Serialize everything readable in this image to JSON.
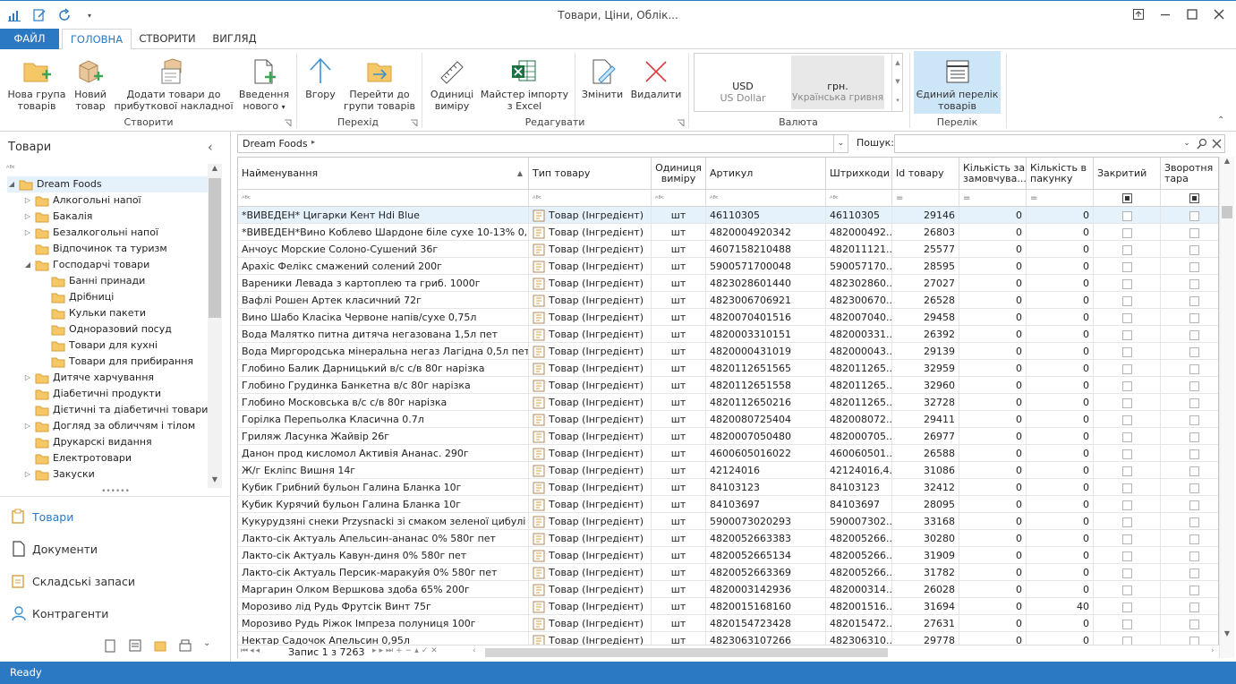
{
  "window": {
    "title": "Товари, Ціни, Облік..."
  },
  "tabs": [
    "ФАЙЛ",
    "ГОЛОВНА",
    "СТВОРИТИ",
    "ВИГЛЯД"
  ],
  "ribbon": {
    "create": {
      "label": "Створити",
      "b1": "Нова група товарів",
      "b2": "Новий товар",
      "b3": "Додати товари до прибуткової накладної",
      "b4": "Введення нового"
    },
    "nav": {
      "label": "Перехід",
      "b1": "Вгору",
      "b2": "Перейти до групи товарів"
    },
    "edit": {
      "label": "Редагувати",
      "b1": "Одиниці виміру",
      "b2": "Майстер імпорту з Excel",
      "b3": "Змінити",
      "b4": "Видалити"
    },
    "currency": {
      "label": "Валюта",
      "usd_code": "USD",
      "usd_name": "US Dollar",
      "uah_code": "грн.",
      "uah_name": "Українська гривня"
    },
    "list": {
      "label": "Перелік",
      "b1": "Єдиний перелік товарів"
    }
  },
  "left": {
    "title": "Товари",
    "tree": [
      {
        "label": "Dream Foods",
        "lvl": 0,
        "ex": "◢"
      },
      {
        "label": "Алкогольні напої",
        "lvl": 1,
        "ex": "▷"
      },
      {
        "label": "Бакалія",
        "lvl": 1,
        "ex": "▷"
      },
      {
        "label": "Безалкогольні напої",
        "lvl": 1,
        "ex": "▷"
      },
      {
        "label": "Відпочинок та туризм",
        "lvl": 1,
        "ex": ""
      },
      {
        "label": "Господарчі товари",
        "lvl": 1,
        "ex": "◢"
      },
      {
        "label": "Банні принади",
        "lvl": 2,
        "ex": ""
      },
      {
        "label": "Дрібниці",
        "lvl": 2,
        "ex": ""
      },
      {
        "label": "Кульки пакети",
        "lvl": 2,
        "ex": ""
      },
      {
        "label": "Одноразовий посуд",
        "lvl": 2,
        "ex": ""
      },
      {
        "label": "Товари для кухні",
        "lvl": 2,
        "ex": ""
      },
      {
        "label": "Товари для прибирання",
        "lvl": 2,
        "ex": ""
      },
      {
        "label": "Дитяче харчування",
        "lvl": 1,
        "ex": "▷"
      },
      {
        "label": "Діабетичні продукти",
        "lvl": 1,
        "ex": ""
      },
      {
        "label": "Дієтичні та діабетичні товари",
        "lvl": 1,
        "ex": ""
      },
      {
        "label": "Догляд за обличчям і тілом",
        "lvl": 1,
        "ex": "▷"
      },
      {
        "label": "Друкарскі видання",
        "lvl": 1,
        "ex": ""
      },
      {
        "label": "Електротовари",
        "lvl": 1,
        "ex": ""
      },
      {
        "label": "Закуски",
        "lvl": 1,
        "ex": "▷"
      }
    ],
    "nav": [
      "Товари",
      "Документи",
      "Складські запаси",
      "Контрагенти"
    ]
  },
  "grid": {
    "breadcrumb": "Dream Foods",
    "search_label": "Пошук:",
    "columns": [
      "Найменування",
      "Тип товару",
      "Одиниця виміру",
      "Артикул",
      "Штрихкоди",
      "Id товару",
      "Кількість за замовчува...",
      "Кількість в пакунку",
      "Закритий",
      "Зворотня тара"
    ],
    "type": "Товар (Інгредієнт)",
    "unit": "шт",
    "rows": [
      [
        "*ВИВЕДЕН* Цигарки Кент Hdi Blue",
        "46110305",
        "46110305",
        "29146",
        "0",
        "0"
      ],
      [
        "*ВИВЕДЕН*Вино Коблево Шардоне біле сухе 10-13% 0,7л",
        "4820004920342",
        "482000492...",
        "26803",
        "0",
        "0"
      ],
      [
        "Анчоус Морские Солоно-Сушений 36г",
        "4607158210488",
        "482011121...",
        "25577",
        "0",
        "0"
      ],
      [
        "Арахіс Фелікс смажений солений 200г",
        "5900571700048",
        "590057170...",
        "28595",
        "0",
        "0"
      ],
      [
        "Вареники Левада з картоплею та гриб. 1000г",
        "4823028601440",
        "482302860...",
        "27027",
        "0",
        "0"
      ],
      [
        "Вафлі Рошен Артек класичний 72г",
        "4823006706921",
        "482300670...",
        "26528",
        "0",
        "0"
      ],
      [
        "Вино Шабо Класіка Червоне напів/сухе 0,75л",
        "4820070401516",
        "482007040...",
        "29458",
        "0",
        "0"
      ],
      [
        "Вода Малятко питна дитяча негазована 1,5л пет",
        "4820003310151",
        "482000331...",
        "26392",
        "0",
        "0"
      ],
      [
        "Вода Миргородська мінеральна негаз Лагідна 0,5л пет",
        "4820000431019",
        "482000043...",
        "29139",
        "0",
        "0"
      ],
      [
        "Глобино Балик Дарницький в/с с/в 80г нарізка",
        "4820112651565",
        "482011265...",
        "32959",
        "0",
        "0"
      ],
      [
        "Глобино Грудинка Банкетна в/с 80г нарізка",
        "4820112651558",
        "482011265...",
        "32960",
        "0",
        "0"
      ],
      [
        "Глобино Московська в/с с/в 80г нарізка",
        "4820112650216",
        "482011265...",
        "32728",
        "0",
        "0"
      ],
      [
        "Горілка Перепьолка Класична 0.7л",
        "4820080725404",
        "482008072...",
        "29411",
        "0",
        "0"
      ],
      [
        "Гриляж Ласунка Жайвір 26г",
        "4820007050480",
        "482000705...",
        "26977",
        "0",
        "0"
      ],
      [
        "Данон прод кисломол Активія Ананас. 290г",
        "4600605016022",
        "460060501...",
        "26588",
        "0",
        "0"
      ],
      [
        "Ж/г Екліпс Вишня 14г",
        "42124016",
        "42124016,4...",
        "31086",
        "0",
        "0"
      ],
      [
        "Кубик Грибний бульон Галина Бланка 10г",
        "84103123",
        "84103123",
        "32412",
        "0",
        "0"
      ],
      [
        "Кубик Курячий бульон Галина Бланка 10г",
        "84103697",
        "84103697",
        "28095",
        "0",
        "0"
      ],
      [
        "Кукурудзяні снеки Przysnacki зі смаком зеленої цибулі 150г",
        "5900073020293",
        "590007302...",
        "33168",
        "0",
        "0"
      ],
      [
        "Лакто-сік Актуаль Апельсин-ананас 0% 580г пет",
        "4820052663383",
        "482005266...",
        "30280",
        "0",
        "0"
      ],
      [
        "Лакто-сік Актуаль Кавун-диня 0% 580г пет",
        "4820052665134",
        "482005266...",
        "31909",
        "0",
        "0"
      ],
      [
        "Лакто-сік Актуаль Персик-маракуйя 0% 580г пет",
        "4820052663369",
        "482005266...",
        "31782",
        "0",
        "0"
      ],
      [
        "Маргарин Олком Вершкова здоба 65% 200г",
        "4820003142936",
        "482000314...",
        "26028",
        "0",
        "0"
      ],
      [
        "Морозиво лід Рудь Фрутсік Винт 75г",
        "4820015168160",
        "482001516...",
        "31694",
        "0",
        "40"
      ],
      [
        "Морозиво Рудь Ріжок Імпреза  полуниця 100г",
        "4820154723428",
        "482015472...",
        "27631",
        "0",
        "0"
      ],
      [
        "Нектар Садочок Апельсин 0,95л",
        "4823063107266",
        "482306310...",
        "29778",
        "0",
        "0"
      ]
    ],
    "pager": "Запис 1 з 7263"
  },
  "status": "Ready",
  "colors": {
    "accent": "#2b79c2",
    "selected": "#cde6f7",
    "list_btn": "#cde6f7"
  }
}
